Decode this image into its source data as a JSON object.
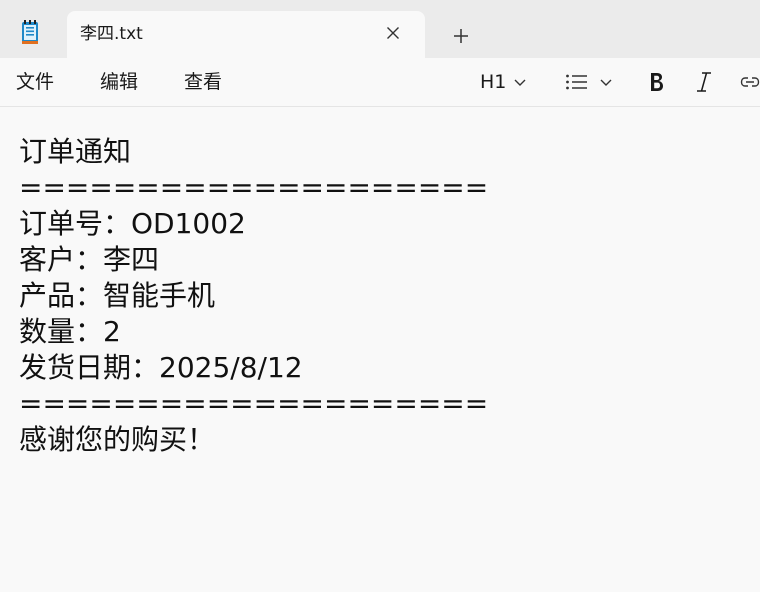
{
  "tab": {
    "title": "李四.txt",
    "close_icon": "close-icon",
    "new_tab_icon": "plus-icon"
  },
  "menu": {
    "file": "文件",
    "edit": "编辑",
    "view": "查看"
  },
  "toolbar": {
    "heading_label": "H1",
    "heading_icon": "chevron-down-icon",
    "list_icon": "bulleted-list-icon",
    "bold_icon": "bold-icon",
    "italic_icon": "italic-icon",
    "link_icon": "link-icon"
  },
  "document": {
    "lines": [
      "订单通知",
      "====================",
      "订单号：OD1002",
      "客户：李四",
      "产品：智能手机",
      "数量：2",
      "发货日期：2025/8/12",
      "====================",
      "感谢您的购买！"
    ]
  },
  "colors": {
    "tabbar_bg": "#ebebeb",
    "editor_bg": "#f9f9f9",
    "app_icon_blue": "#1e88c8",
    "app_icon_accent": "#e07020"
  }
}
